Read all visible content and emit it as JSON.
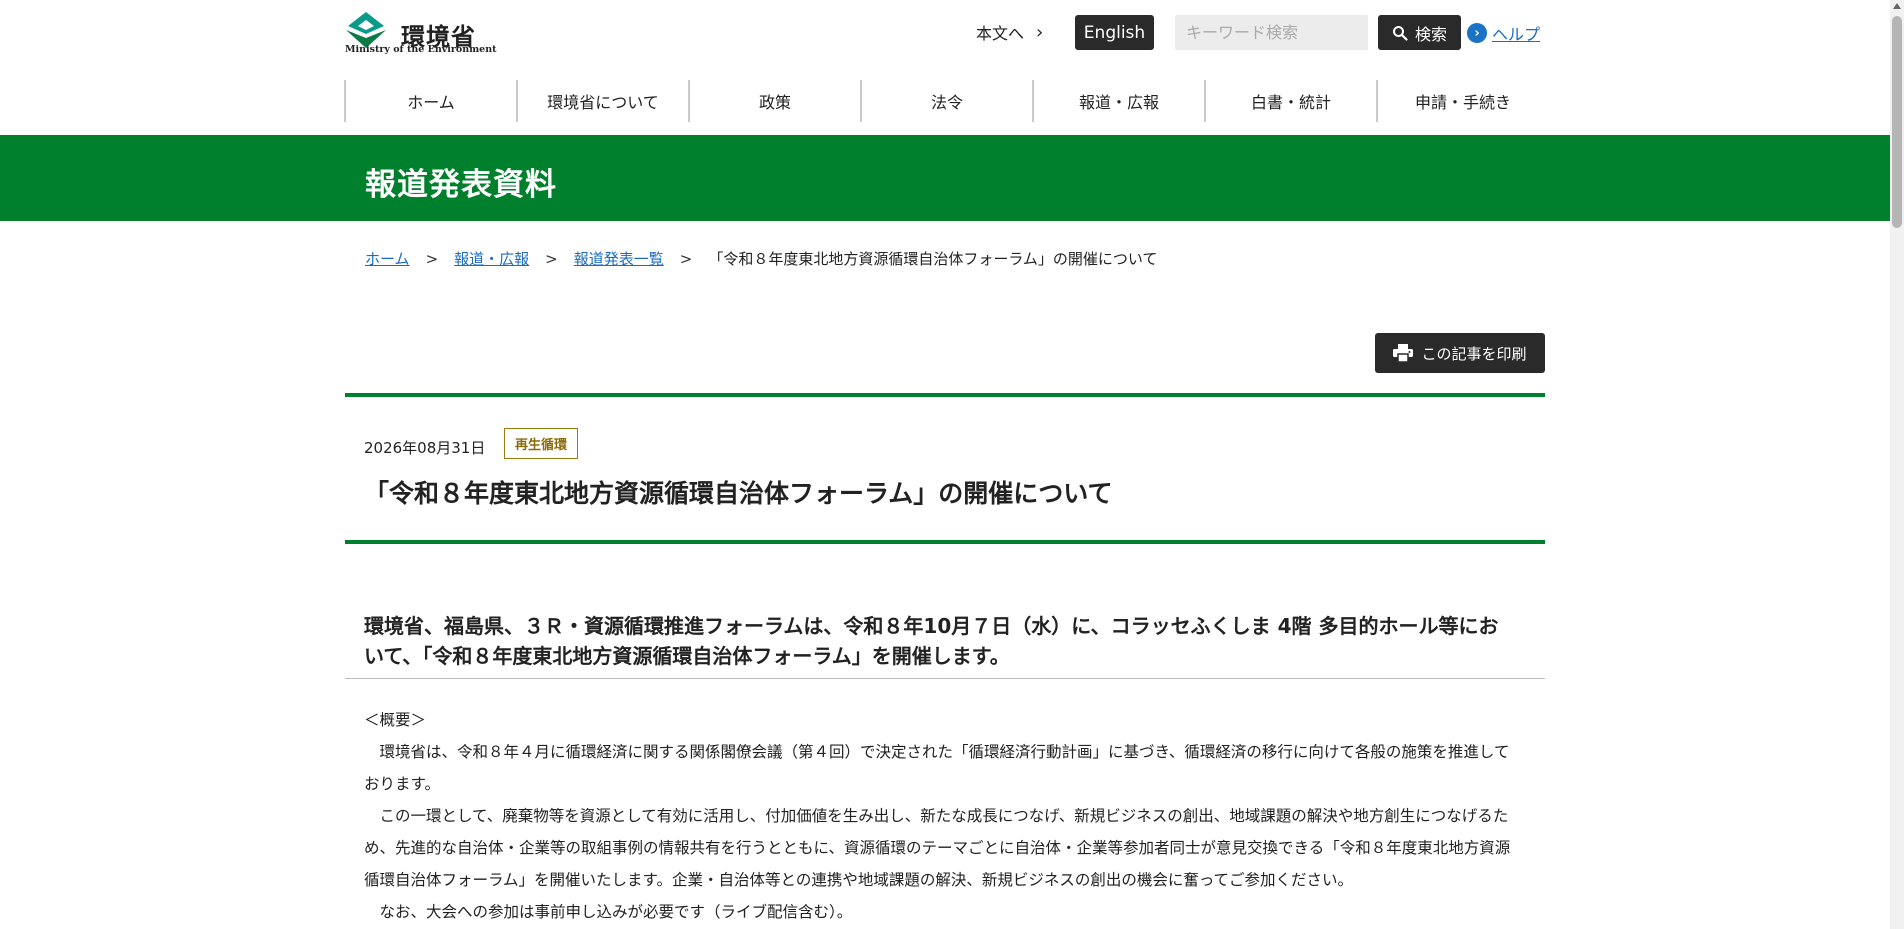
{
  "header": {
    "logo_ja": "環境省",
    "logo_en": "Ministry of the Environment",
    "skip_link": "本文へ",
    "english_label": "English",
    "search_placeholder": "キーワード検索",
    "search_label": "検索",
    "help_label": "ヘルプ"
  },
  "nav": {
    "items": [
      {
        "label": "ホーム"
      },
      {
        "label": "環境省について"
      },
      {
        "label": "政策"
      },
      {
        "label": "法令"
      },
      {
        "label": "報道・広報"
      },
      {
        "label": "白書・統計"
      },
      {
        "label": "申請・手続き"
      }
    ]
  },
  "banner": {
    "title": "報道発表資料"
  },
  "breadcrumb": {
    "items": [
      {
        "label": "ホーム"
      },
      {
        "label": "報道・広報"
      },
      {
        "label": "報道発表一覧"
      }
    ],
    "separator": ">",
    "current": "「令和８年度東北地方資源循環自治体フォーラム」の開催について"
  },
  "print_label": "この記事を印刷",
  "article": {
    "date": "2026年08月31日",
    "tag": "再生循環",
    "title": "「令和８年度東北地方資源循環自治体フォーラム」の開催について",
    "lead": "環境省、福島県、３Ｒ・資源循環推進フォーラムは、令和８年10月７日（水）に、コラッセふくしま 4階 多目的ホール等において、「令和８年度東北地方資源循環自治体フォーラム」を開催します。",
    "section_heading": "＜概要＞",
    "paragraphs": [
      "　環境省は、令和８年４月に循環経済に関する関係閣僚会議（第４回）で決定された「循環経済行動計画」に基づき、循環経済の移行に向けて各般の施策を推進しております。",
      "　この一環として、廃棄物等を資源として有効に活用し、付加価値を生み出し、新たな成長につなげ、新規ビジネスの創出、地域課題の解決や地方創生につなげるため、先進的な自治体・企業等の取組事例の情報共有を行うとともに、資源循環のテーマごとに自治体・企業等参加者同士が意見交換できる「令和８年度東北地方資源循環自治体フォーラム」を開催いたします。企業・自治体等との連携や地域課題の解決、新規ビジネスの創出の機会に奮ってご参加ください。",
      "　なお、大会への参加は事前申し込みが必要です（ライブ配信含む）。"
    ]
  },
  "colors": {
    "brand_green": "#007f2d",
    "dark_button": "#2a2a2a",
    "link_blue": "#1a6bc1",
    "tag_gold": "#9d7a11"
  },
  "icons": [
    "ministry-logo",
    "chevron-right-icon",
    "search-icon",
    "help-chevron-icon",
    "printer-icon"
  ]
}
